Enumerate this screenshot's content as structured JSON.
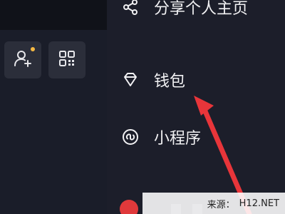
{
  "left_panel": {
    "add_friend_icon": "add-friend-icon",
    "qr_code_icon": "qr-code-icon",
    "notify_color": "#f5b944"
  },
  "menu": {
    "items": [
      {
        "icon": "share-icon",
        "label": "分享个人主页"
      },
      {
        "icon": "wallet-icon",
        "label": "钱包"
      },
      {
        "icon": "mini-program-icon",
        "label": "小程序"
      }
    ]
  },
  "annotation": {
    "arrow_color": "#e8353a"
  },
  "watermark": {
    "label": "来源：",
    "site": "H12.NET"
  },
  "colors": {
    "background": "#161823",
    "drawer": "#1c1e2a",
    "text": "#f1f1f3"
  }
}
